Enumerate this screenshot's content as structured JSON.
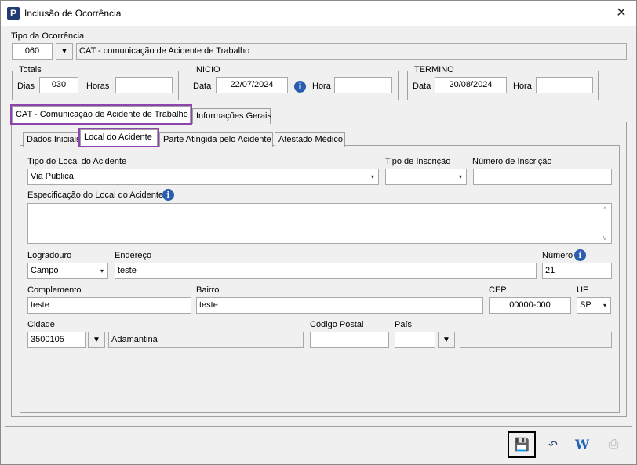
{
  "window": {
    "title": "Inclusão de Ocorrência",
    "close_glyph": "✕"
  },
  "tipo_ocorrencia": {
    "label": "Tipo da Ocorrência",
    "code": "060",
    "description": "CAT - comunicação de Acidente de Trabalho"
  },
  "totais": {
    "group_label": "Totais",
    "dias_label": "Dias",
    "dias_value": "030",
    "horas_label": "Horas",
    "horas_value": ""
  },
  "inicio": {
    "group_label": "INICIO",
    "data_label": "Data",
    "data_value": "22/07/2024",
    "hora_label": "Hora",
    "hora_value": ""
  },
  "termino": {
    "group_label": "TERMINO",
    "data_label": "Data",
    "data_value": "20/08/2024",
    "hora_label": "Hora",
    "hora_value": ""
  },
  "outer_tabs": [
    {
      "label": "CAT - Comunicação de Acidente de Trabalho",
      "active": true
    },
    {
      "label": "Informações Gerais",
      "active": false
    }
  ],
  "inner_tabs": [
    {
      "label": "Dados Iniciais",
      "active": false
    },
    {
      "label": "Local do Acidente",
      "active": true
    },
    {
      "label": "Parte Atingida pelo Acidente",
      "active": false
    },
    {
      "label": "Atestado Médico",
      "active": false
    }
  ],
  "local": {
    "tipo_local_label": "Tipo do Local do Acidente",
    "tipo_local_value": "Via Pública",
    "tipo_inscricao_label": "Tipo de Inscrição",
    "tipo_inscricao_value": "",
    "numero_inscricao_label": "Número de Inscrição",
    "numero_inscricao_value": "",
    "especificacao_label": "Especificação do Local do Acidente",
    "especificacao_value": "",
    "logradouro_label": "Logradouro",
    "logradouro_value": "Campo",
    "endereco_label": "Endereço",
    "endereco_value": "teste",
    "numero_label": "Número",
    "numero_value": "21",
    "complemento_label": "Complemento",
    "complemento_value": "teste",
    "bairro_label": "Bairro",
    "bairro_value": "teste",
    "cep_label": "CEP",
    "cep_value": "00000-000",
    "uf_label": "UF",
    "uf_value": "SP",
    "cidade_label": "Cidade",
    "cidade_code": "3500105",
    "cidade_name": "Adamantina",
    "codigo_postal_label": "Código Postal",
    "codigo_postal_value": "",
    "pais_label": "País",
    "pais_code": "",
    "pais_name": ""
  },
  "icons": {
    "info": "i",
    "dropdown": "▼",
    "small_dropdown": "▾",
    "scroll_up": "^",
    "scroll_down": "v",
    "save": "💾",
    "undo": "↶",
    "word": "W",
    "print": "⎙"
  },
  "colors": {
    "highlight": "#8e44ad",
    "info_blue": "#2a5db0",
    "app_icon": "#1f3d73"
  }
}
